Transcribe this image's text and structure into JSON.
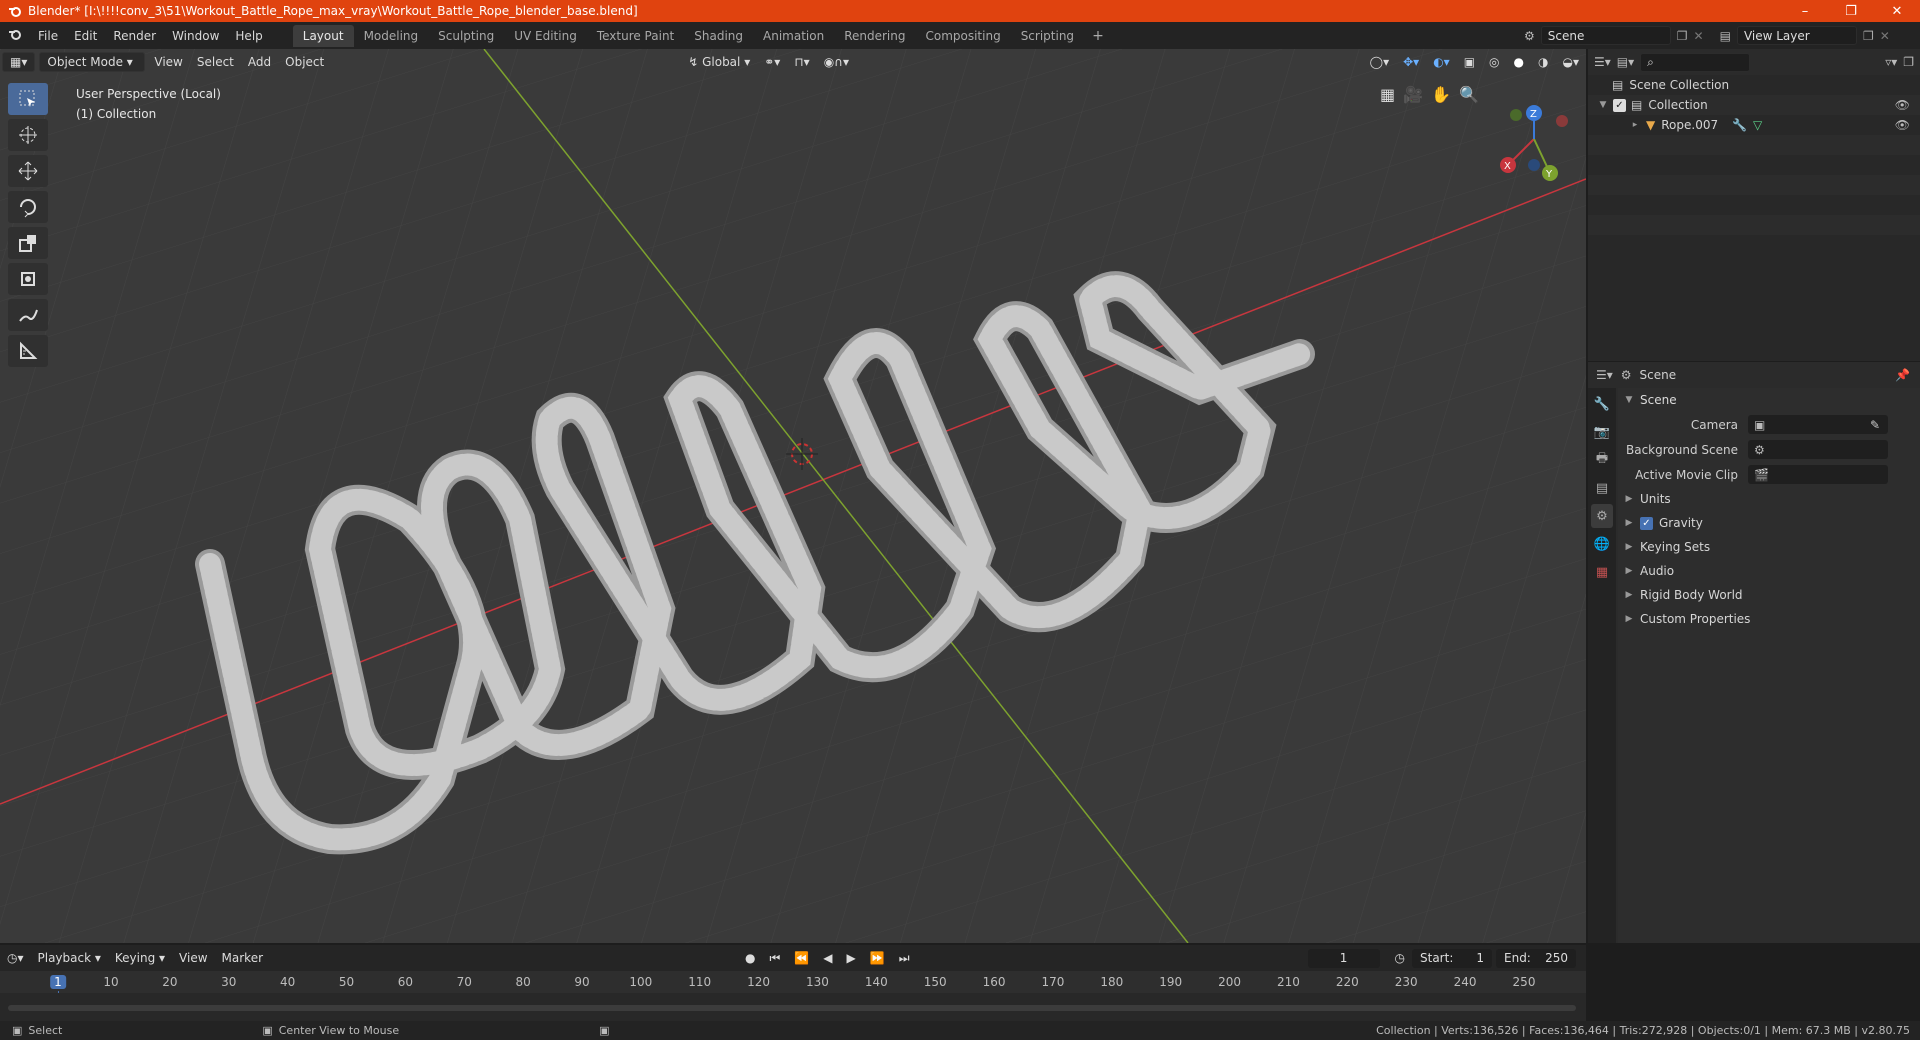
{
  "window": {
    "title": "Blender* [I:\\!!!!conv_3\\51\\Workout_Battle_Rope_max_vray\\Workout_Battle_Rope_blender_base.blend]",
    "minimize": "–",
    "maximize": "❐",
    "close": "✕"
  },
  "menu": [
    "File",
    "Edit",
    "Render",
    "Window",
    "Help"
  ],
  "workspaces": [
    "Layout",
    "Modeling",
    "Sculpting",
    "UV Editing",
    "Texture Paint",
    "Shading",
    "Animation",
    "Rendering",
    "Compositing",
    "Scripting"
  ],
  "active_workspace": "Layout",
  "scene_selector": {
    "scene": "Scene",
    "view_layer": "View Layer"
  },
  "viewport": {
    "mode": "Object Mode",
    "menus": [
      "View",
      "Select",
      "Add",
      "Object"
    ],
    "transform_orientation": "Global",
    "overlay_line1": "User Perspective (Local)",
    "overlay_line2": "(1) Collection",
    "gizmo": {
      "x": "X",
      "y": "Y",
      "z": "Z"
    }
  },
  "outliner": {
    "root": "Scene Collection",
    "collection": "Collection",
    "object": "Rope.007"
  },
  "properties": {
    "header_title": "Scene",
    "panel": "Scene",
    "fields": [
      {
        "label": "Camera",
        "value": ""
      },
      {
        "label": "Background Scene",
        "value": ""
      },
      {
        "label": "Active Movie Clip",
        "value": ""
      }
    ],
    "subpanels": [
      "Units",
      "Gravity",
      "Keying Sets",
      "Audio",
      "Rigid Body World",
      "Custom Properties"
    ]
  },
  "timeline": {
    "menus": [
      "Playback",
      "Keying",
      "View",
      "Marker"
    ],
    "current_frame": "1",
    "start_label": "Start:",
    "start": "1",
    "end_label": "End:",
    "end": "250",
    "ticks": [
      "1",
      "10",
      "20",
      "30",
      "40",
      "50",
      "60",
      "70",
      "80",
      "90",
      "100",
      "110",
      "120",
      "130",
      "140",
      "150",
      "160",
      "170",
      "180",
      "190",
      "200",
      "210",
      "220",
      "230",
      "240",
      "250"
    ]
  },
  "statusbar": {
    "left": "Select",
    "middle": "Center View to Mouse",
    "right": "Collection | Verts:136,526 | Faces:136,464 | Tris:272,928 | Objects:0/1 | Mem: 67.3 MB | v2.80.75"
  },
  "colors": {
    "accent": "#4772b3",
    "titlebar": "#e0430f",
    "x_axis": "#c8363e",
    "y_axis": "#7da22e"
  }
}
